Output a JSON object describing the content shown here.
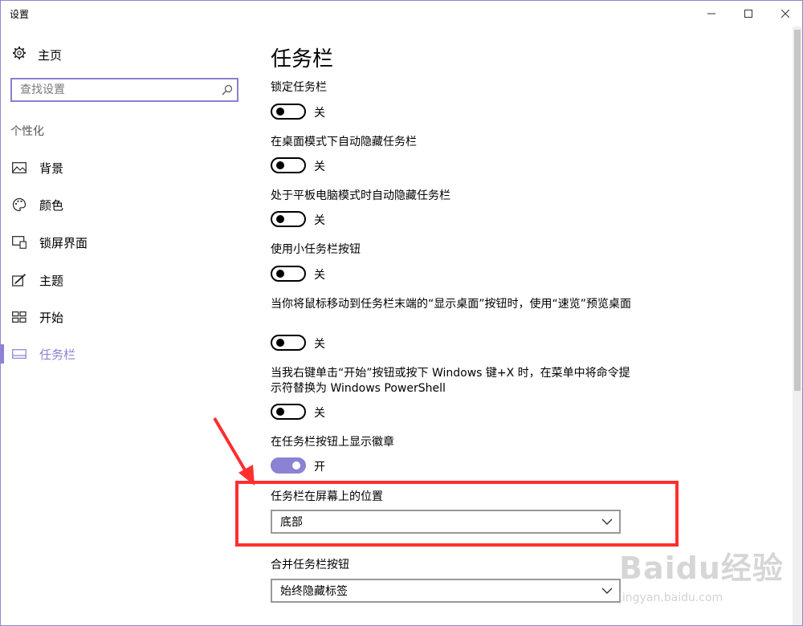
{
  "window": {
    "title": "设置"
  },
  "sidebar": {
    "home_label": "主页",
    "search_placeholder": "查找设置",
    "section_label": "个性化",
    "items": [
      {
        "label": "背景",
        "icon": "picture-icon"
      },
      {
        "label": "颜色",
        "icon": "palette-icon"
      },
      {
        "label": "锁屏界面",
        "icon": "lock-screen-icon"
      },
      {
        "label": "主题",
        "icon": "theme-brush-icon"
      },
      {
        "label": "开始",
        "icon": "start-tiles-icon"
      },
      {
        "label": "任务栏",
        "icon": "taskbar-icon",
        "active": true
      }
    ]
  },
  "content": {
    "title": "任务栏",
    "settings": [
      {
        "label": "锁定任务栏",
        "state": "关",
        "on": false
      },
      {
        "label": "在桌面模式下自动隐藏任务栏",
        "state": "关",
        "on": false
      },
      {
        "label": "处于平板电脑模式时自动隐藏任务栏",
        "state": "关",
        "on": false
      },
      {
        "label": "使用小任务栏按钮",
        "state": "关",
        "on": false
      },
      {
        "label": "当你将鼠标移动到任务栏末端的“显示桌面”按钮时，使用“速览”预览桌面",
        "state": "关",
        "on": false
      },
      {
        "label": "当我右键单击“开始”按钮或按下 Windows 键+X 时，在菜单中将命令提示符替换为 Windows PowerShell",
        "state": "关",
        "on": false
      },
      {
        "label": "在任务栏按钮上显示徽章",
        "state": "开",
        "on": true
      }
    ],
    "position": {
      "label": "任务栏在屏幕上的位置",
      "value": "底部"
    },
    "combine": {
      "label": "合并任务栏按钮",
      "value": "始终隐藏标签"
    }
  },
  "watermark": {
    "brand": "Baidu经验",
    "url": "jingyan.baidu.com"
  },
  "colors": {
    "accent": "#8b82d4",
    "highlight": "#ff2f2f"
  }
}
